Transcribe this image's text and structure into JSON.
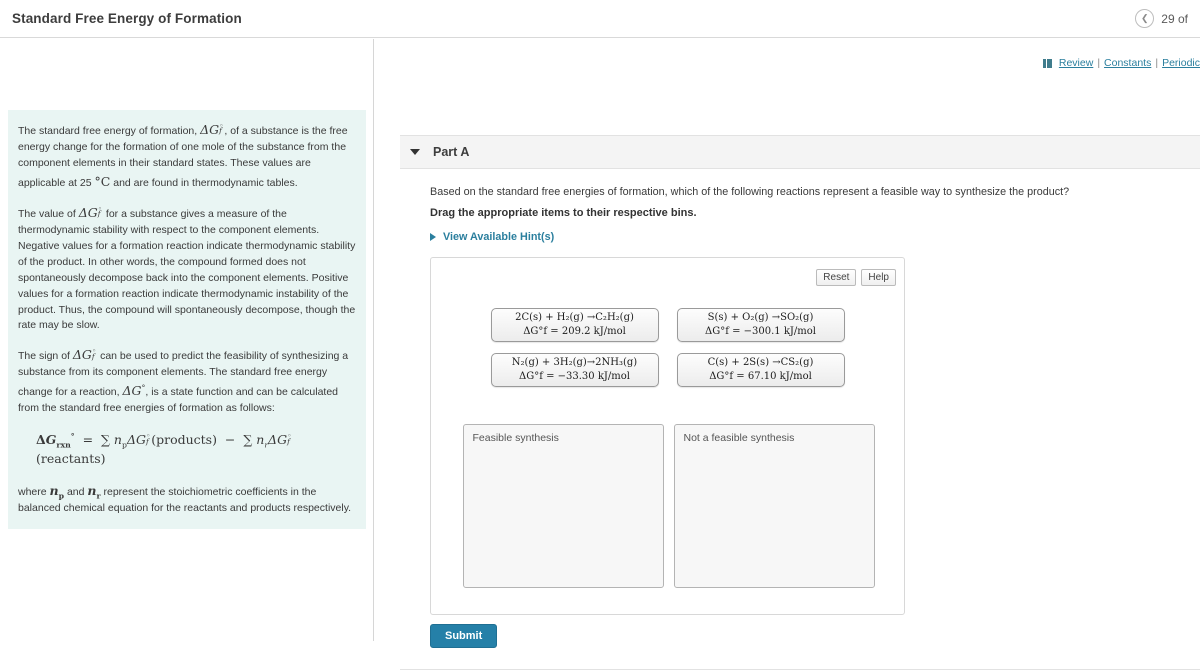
{
  "topbar": {
    "title": "Standard Free Energy of Formation",
    "prev_icon": "chevron-left-icon",
    "pager_text": "29 of"
  },
  "toolbar": {
    "review_label": "Review",
    "constants_label": "Constants",
    "periodic_label": "Periodic",
    "separator": "|",
    "book_icon": "book-icon"
  },
  "sidebar": {
    "paragraphs": [
      "The standard free energy of formation, @DGf@, of a substance is the free energy change for the formation of one mole of the substance from the component elements in their standard states. These values are applicable at 25 @degC@ and are found in thermodynamic tables.",
      "The value of @DGf@ for a substance gives a measure of the thermodynamic stability with respect to the component elements. Negative values for a formation reaction indicate thermodynamic stability of the product. In other words, the compound formed does not spontaneously decompose back into the component elements. Positive values for a formation reaction indicate thermodynamic instability of the product. Thus, the compound will spontaneously decompose, though the rate may be slow.",
      "The sign of @DGf@ can be used to predict the feasibility of synthesizing a substance from its component elements. The standard free energy change for a reaction, @DGo@, is a state function and can be calculated from the standard free energies of formation as follows:"
    ],
    "p1_a": "The standard free energy of formation, ",
    "p1_b": ", of a substance is the free energy change for the formation of one mole of the substance from the component elements in their standard states. These values are applicable at 25 ",
    "p1_c": " and are found in thermodynamic tables.",
    "p2_a": "The value of ",
    "p2_b": " for a substance gives a measure of the thermodynamic stability with respect to the component elements. Negative values for a formation reaction indicate thermodynamic stability of the product. In other words, the compound formed does not spontaneously decompose back into the component elements. Positive values for a formation reaction indicate thermodynamic instability of the product. Thus, the compound will spontaneously decompose, though the rate may be slow.",
    "p3_a": "The sign of ",
    "p3_b": " can be used to predict the feasibility of synthesizing a substance from its component elements. The standard free energy change for a reaction, ",
    "p3_c": ", is a state function and can be calculated from the standard free energies of formation as follows:",
    "equation": "ΔG°rxn = Σ np ΔG°f(products) − Σ nr ΔG°f(reactants)",
    "p4_a": "where ",
    "p4_b": " and ",
    "p4_c": " represent the stoichiometric coefficients in the balanced chemical equation for the reactants and products respectively."
  },
  "part": {
    "collapse_icon": "triangle-down-icon",
    "label": "Part A",
    "question": "Based on the standard free energies of formation, which of the following reactions represent a feasible way to synthesize the product?",
    "instruction": "Drag the appropriate items to their respective bins.",
    "hint_icon": "triangle-right-icon",
    "hint_label": "View Available Hint(s)"
  },
  "answer_area": {
    "reset_label": "Reset",
    "help_label": "Help",
    "tiles": [
      {
        "id": "tile-c2h2",
        "equation": "2C(s) + H₂(g) →C₂H₂(g)",
        "delta_g": "ΔG°f = 209.2 kJ/mol",
        "value": 209.2,
        "unit": "kJ/mol"
      },
      {
        "id": "tile-so2",
        "equation": "S(s) + O₂(g) →SO₂(g)",
        "delta_g": "ΔG°f = −300.1 kJ/mol",
        "value": -300.1,
        "unit": "kJ/mol"
      },
      {
        "id": "tile-nh3",
        "equation": "N₂(g) + 3H₂(g)→2NH₃(g)",
        "delta_g": "ΔG°f = −33.30 kJ/mol",
        "value": -33.3,
        "unit": "kJ/mol"
      },
      {
        "id": "tile-cs2",
        "equation": "C(s) + 2S(s) →CS₂(g)",
        "delta_g": "ΔG°f = 67.10 kJ/mol",
        "value": 67.1,
        "unit": "kJ/mol"
      }
    ],
    "bins": [
      {
        "id": "bin-feasible",
        "label": "Feasible synthesis",
        "items": []
      },
      {
        "id": "bin-not-feasible",
        "label": "Not a feasible synthesis",
        "items": []
      }
    ]
  },
  "footer": {
    "submit_label": "Submit"
  },
  "colors": {
    "accent_link": "#2b7f9e",
    "submit_bg": "#2580a8",
    "sidebar_card_bg": "#e9f5f3",
    "part_header_bg": "#f4f4f4"
  }
}
